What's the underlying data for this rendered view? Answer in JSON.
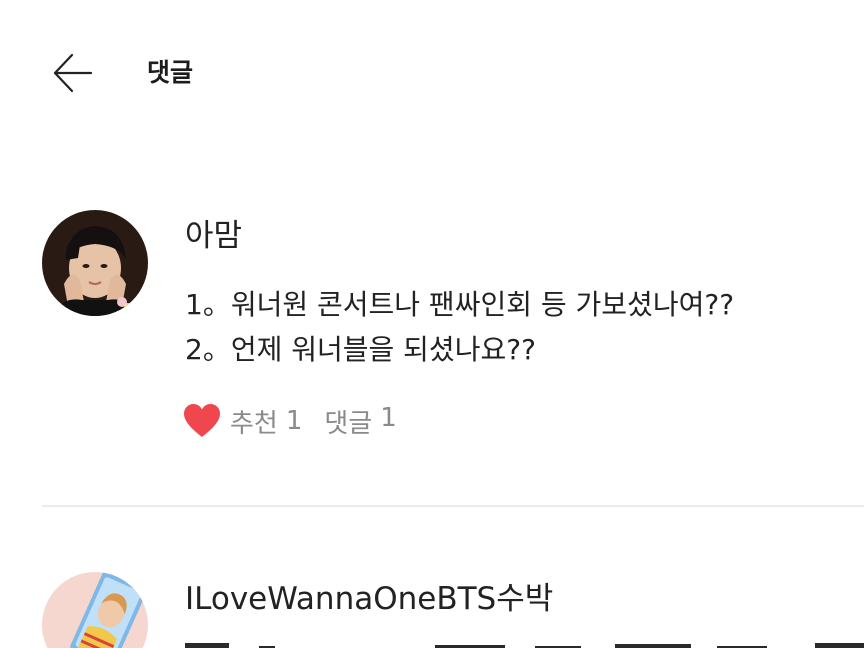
{
  "header": {
    "title": "댓글",
    "back_icon": "arrow-left-icon"
  },
  "comments": [
    {
      "author": "아맘",
      "lines": [
        "1。워너원 콘서트나 팬싸인회 등 가보셨나여??",
        "2。언제 워너블을 되셨나요??"
      ],
      "like_icon": "heart-icon",
      "like_label": "추천",
      "like_count": "1",
      "reply_label": "댓글",
      "reply_count": "1"
    },
    {
      "author": "ILoveWannaOneBTS수박"
    }
  ],
  "colors": {
    "heart": "#f0464e",
    "meta_text": "#8a8a8a",
    "divider": "#ebebeb"
  }
}
